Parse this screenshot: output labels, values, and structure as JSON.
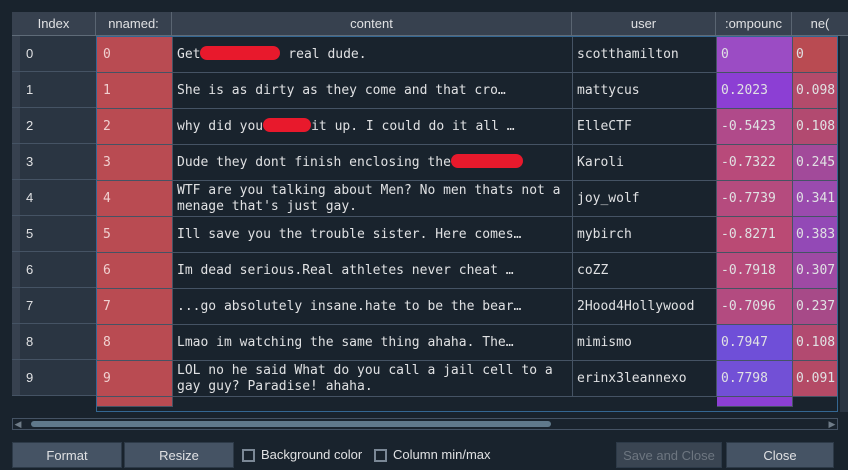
{
  "headers": {
    "index": "Index",
    "unnamed": "nnamed:",
    "content": "content",
    "user": "user",
    "compound": ":ompounc",
    "neg": "ne("
  },
  "rows": [
    {
      "index": "0",
      "unnamed": "0",
      "content_a": "Get",
      "content_b": " real dude.",
      "user": "scotthamilton",
      "compound": "0",
      "neg": "0"
    },
    {
      "index": "1",
      "unnamed": "1",
      "content": " She is as dirty as they come  and that cro…",
      "user": "mattycus",
      "compound": "0.2023",
      "neg": "0.098"
    },
    {
      "index": "2",
      "unnamed": "2",
      "content_a": " why did you",
      "content_b": "it up. I could do it all …",
      "user": "ElleCTF",
      "compound": "-0.5423",
      "neg": "0.108"
    },
    {
      "index": "3",
      "unnamed": "3",
      "content_a": " Dude they dont finish enclosing the",
      "content_b": "",
      "user": "Karoli",
      "compound": "-0.7322",
      "neg": "0.245"
    },
    {
      "index": "4",
      "unnamed": "4",
      "content": " WTF are you talking about Men? No men thats not a menage  that's just gay.",
      "user": "joy_wolf",
      "compound": "-0.7739",
      "neg": "0.341"
    },
    {
      "index": "5",
      "unnamed": "5",
      "content": "Ill save you the trouble sister. Here comes…",
      "user": "mybirch",
      "compound": "-0.8271",
      "neg": "0.383"
    },
    {
      "index": "6",
      "unnamed": "6",
      "content": " Im dead serious.Real athletes never cheat …",
      "user": "coZZ",
      "compound": "-0.7918",
      "neg": "0.307"
    },
    {
      "index": "7",
      "unnamed": "7",
      "content": "...go absolutely insane.hate to be the bear…",
      "user": "2Hood4Hollywood",
      "compound": "-0.7096",
      "neg": "0.237"
    },
    {
      "index": "8",
      "unnamed": "8",
      "content": "Lmao  im watching the same thing ahaha. The…",
      "user": "mimismo",
      "compound": "0.7947",
      "neg": "0.108"
    },
    {
      "index": "9",
      "unnamed": "9",
      "content": "LOL  no he said  What do you call a jail cell to a gay guy? Paradise! ahaha.",
      "user": "erinx3leannexo",
      "compound": "0.7798",
      "neg": "0.091"
    }
  ],
  "compound_colors": [
    "#9b4cc4",
    "#8c3fd4",
    "#b04a8a",
    "#b84a7a",
    "#b54b7e",
    "#ba4a74",
    "#b74b7b",
    "#b34b80",
    "#6f4fd8",
    "#7250d6"
  ],
  "neg_colors": [
    "#b94b52",
    "#b34b6b",
    "#b24a70",
    "#a24a9a",
    "#9a4bae",
    "#9349b6",
    "#9e4aa4",
    "#a74a88",
    "#b24a70",
    "#b44a66"
  ],
  "buttons": {
    "format": "Format",
    "resize": "Resize",
    "background_color": "Background color",
    "column_minmax": "Column min/max",
    "save_and_close": "Save and Close",
    "close": "Close"
  }
}
